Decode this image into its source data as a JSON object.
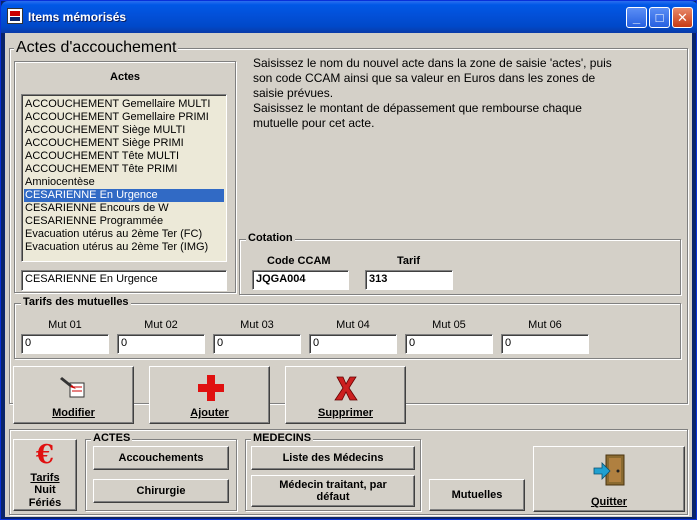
{
  "window": {
    "title": "Items mémorisés"
  },
  "acts_group": {
    "title": "Actes d'accouchement",
    "list_header": "Actes",
    "items": [
      "ACCOUCHEMENT Gemellaire MULTI",
      "ACCOUCHEMENT Gemellaire PRIMI",
      "ACCOUCHEMENT Siège MULTI",
      "ACCOUCHEMENT Siège PRIMI",
      "ACCOUCHEMENT Tête MULTI",
      "ACCOUCHEMENT Tête PRIMI",
      "Amniocentèse",
      "CESARIENNE En Urgence",
      "CESARIENNE Encours de W",
      "CESARIENNE Programmée",
      "Evacuation utérus au 2ème Ter (FC)",
      "Evacuation utérus au 2ème Ter (IMG)"
    ],
    "selected_index": 7,
    "act_input_value": "CESARIENNE En Urgence"
  },
  "instructions": "Saisissez le nom du nouvel acte dans la zone de saisie 'actes', puis\nson code CCAM ainsi que sa valeur en Euros dans les zones de\nsaisie prévues.\nSaisissez le montant de dépassement que rembourse chaque\nmutuelle pour cet acte.",
  "cotation": {
    "title": "Cotation",
    "code_label": "Code CCAM",
    "code_value": "JQGA004",
    "tarif_label": "Tarif",
    "tarif_value": "313"
  },
  "mutuelles": {
    "title": "Tarifs des mutuelles",
    "fields": [
      {
        "label": "Mut 01",
        "value": "0"
      },
      {
        "label": "Mut 02",
        "value": "0"
      },
      {
        "label": "Mut 03",
        "value": "0"
      },
      {
        "label": "Mut 04",
        "value": "0"
      },
      {
        "label": "Mut 05",
        "value": "0"
      },
      {
        "label": "Mut 06",
        "value": "0"
      }
    ]
  },
  "actions": {
    "modify": "Modifier",
    "add": "Ajouter",
    "delete": "Supprimer"
  },
  "bottom": {
    "tarifs_line1": "Tarifs",
    "tarifs_line2": "Nuit",
    "tarifs_line3": "Fériés",
    "actes_title": "ACTES",
    "accouchements": "Accouchements",
    "chirurgie": "Chirurgie",
    "medecins_title": "MEDECINS",
    "liste_medecins": "Liste des Médecins",
    "medecin_traitant_line1": "Médecin traitant, par",
    "medecin_traitant_line2": "défaut",
    "mutuelles": "Mutuelles",
    "quitter": "Quitter"
  },
  "colors": {
    "selection": "#316ac5",
    "window_bg": "#d4d0c8",
    "add_icon": "#e01010",
    "delete_icon": "#cc2020"
  }
}
